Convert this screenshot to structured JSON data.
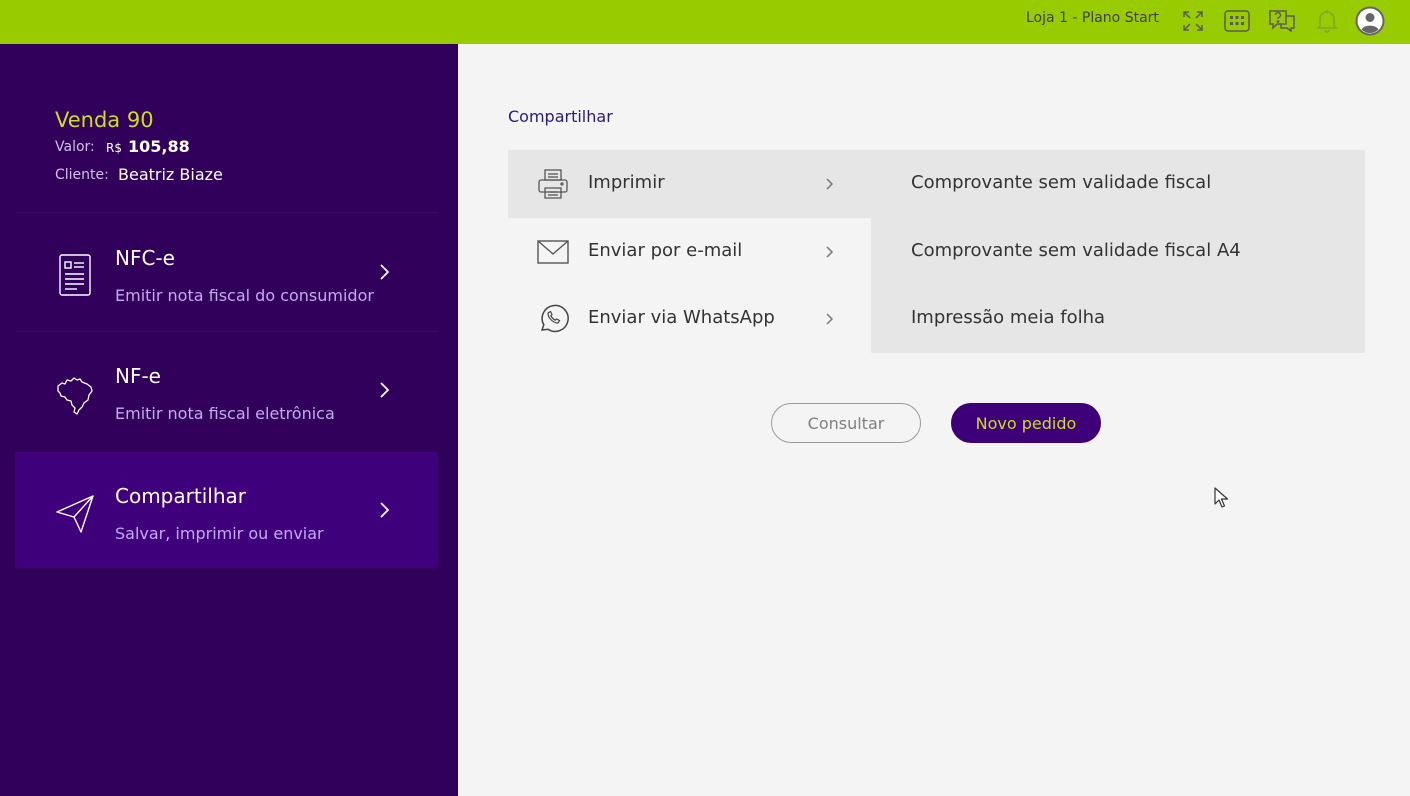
{
  "topbar": {
    "store_label": "Loja 1 - Plano Start",
    "icons": [
      "fullscreen-icon",
      "apps-grid-icon",
      "help-chat-icon",
      "bell-icon",
      "user-avatar-icon"
    ],
    "background": "#99cc00"
  },
  "sidebar": {
    "sale_title": "Venda 90",
    "valor_label": "Valor:",
    "currency": "R$",
    "valor": "105,88",
    "cliente_label": "Cliente:",
    "cliente": "Beatriz Biaze",
    "items": [
      {
        "title": "NFC-e",
        "subtitle": "Emitir nota fiscal do consumidor",
        "icon": "receipt-icon",
        "active": false
      },
      {
        "title": "NF-e",
        "subtitle": "Emitir nota fiscal eletrônica",
        "icon": "brazil-map-icon",
        "active": false
      },
      {
        "title": "Compartilhar",
        "subtitle": "Salvar, imprimir ou enviar",
        "icon": "send-icon",
        "active": true
      }
    ],
    "background": "#30005a",
    "accent": "#ccdd22"
  },
  "main": {
    "breadcrumb": "Compartilhar",
    "options": [
      {
        "label": "Imprimir",
        "icon": "printer-icon",
        "selected": true
      },
      {
        "label": "Enviar por e-mail",
        "icon": "envelope-icon",
        "selected": false
      },
      {
        "label": "Enviar via WhatsApp",
        "icon": "whatsapp-icon",
        "selected": false
      }
    ],
    "print_options": [
      "Comprovante sem validade fiscal",
      "Comprovante sem validade fiscal A4",
      "Impressão meia folha"
    ],
    "buttons": {
      "consultar": "Consultar",
      "novo_pedido": "Novo pedido"
    }
  }
}
